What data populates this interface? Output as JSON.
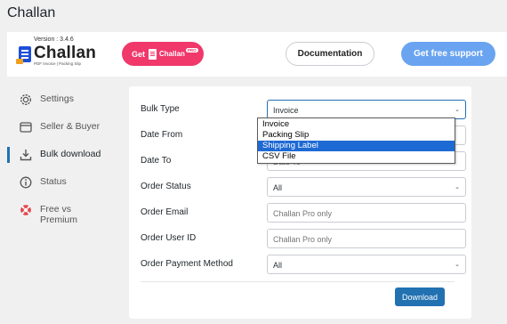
{
  "page": {
    "title": "Challan"
  },
  "header": {
    "version": "Version : 3.4.6",
    "logo_text": "Challan",
    "logo_sub": "PDF Invoice | Packing Slip",
    "get_label": "Get",
    "get_brand": "Challan",
    "get_badge": "PRO",
    "documentation": "Documentation",
    "support": "Get free support",
    "colors": {
      "pink": "#f0386b",
      "blue": "#6aa4f0",
      "brand": "#1e4fd8"
    }
  },
  "sidebar": {
    "items": [
      {
        "label": "Settings",
        "icon": "gear-icon"
      },
      {
        "label": "Seller & Buyer",
        "icon": "window-icon"
      },
      {
        "label": "Bulk download",
        "icon": "download-icon",
        "active": true
      },
      {
        "label": "Status",
        "icon": "info-icon"
      },
      {
        "label_line1": "Free vs",
        "label_line2": "Premium",
        "icon": "lifebuoy-icon"
      }
    ]
  },
  "form": {
    "bulk_type": {
      "label": "Bulk Type",
      "value": "Invoice"
    },
    "date_from": {
      "label": "Date From"
    },
    "date_to": {
      "label": "Date To",
      "placeholder": "Date To"
    },
    "order_status": {
      "label": "Order Status",
      "value": "All"
    },
    "order_email": {
      "label": "Order Email",
      "placeholder": "Challan Pro only"
    },
    "order_user_id": {
      "label": "Order User ID",
      "placeholder": "Challan Pro only"
    },
    "order_payment_method": {
      "label": "Order Payment Method",
      "value": "All"
    },
    "download": "Download"
  },
  "dropdown": {
    "options": [
      "Invoice",
      "Packing Slip",
      "Shipping Label",
      "CSV File"
    ],
    "highlighted": "Shipping Label"
  }
}
